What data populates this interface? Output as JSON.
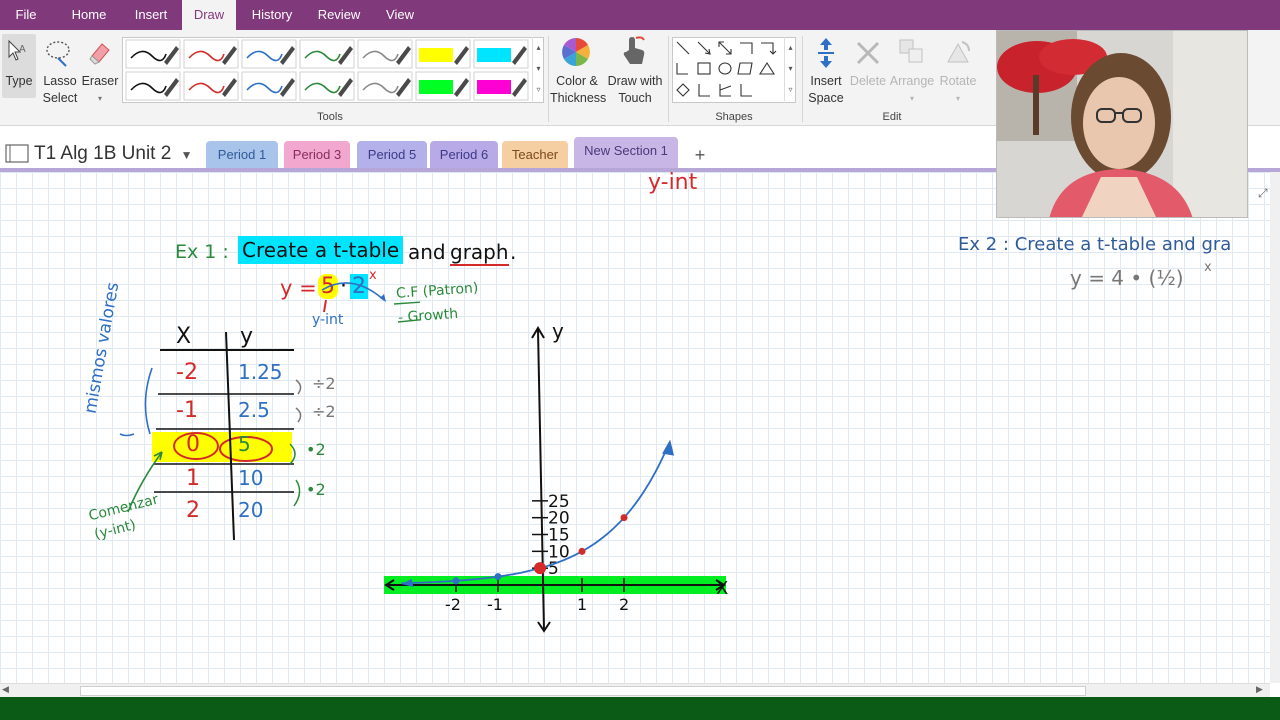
{
  "menu": {
    "items": [
      "File",
      "Home",
      "Insert",
      "Draw",
      "History",
      "Review",
      "View"
    ],
    "active": "Draw"
  },
  "ribbon": {
    "tools_group": {
      "type": "Type",
      "lasso_line1": "Lasso",
      "lasso_line2": "Select",
      "eraser": "Eraser",
      "label": "Tools"
    },
    "pens": {
      "row1": [
        "#111111",
        "#d42a2a",
        "#2f6fc4",
        "#2a8a3a",
        "#8a8a8a",
        "#ffff00",
        "#00e5ff"
      ],
      "row2": [
        "#111111",
        "#d42a2a",
        "#2f6fc4",
        "#2a8a3a",
        "#8a8a8a",
        "#00ff22",
        "#ff00d4"
      ]
    },
    "color_line1": "Color &",
    "color_line2": "Thickness",
    "touch_line1": "Draw with",
    "touch_line2": "Touch",
    "shapes_label": "Shapes",
    "edit": {
      "insert_line1": "Insert",
      "insert_line2": "Space",
      "delete": "Delete",
      "arrange": "Arrange",
      "rotate": "Rotate",
      "label": "Edit"
    }
  },
  "notebook": {
    "name": "T1 Alg 1B Unit 2",
    "tabs": [
      {
        "label": "Period 1",
        "color": "#a9c4ea",
        "text": "#2f5b9a"
      },
      {
        "label": "Period 3",
        "color": "#f2a7cf",
        "text": "#8a2c5f"
      },
      {
        "label": "Period 5",
        "color": "#b4b1ea",
        "text": "#3d3a8a"
      },
      {
        "label": "Period 6",
        "color": "#b8aae6",
        "text": "#3d3a8a"
      },
      {
        "label": "Teacher",
        "color": "#f5cfa2",
        "text": "#7a4a1a"
      },
      {
        "label": "New Section 1",
        "color": "#c8b6e6",
        "text": "#4a3a7a"
      }
    ],
    "add_tab": "+"
  },
  "page": {
    "top_note": "y-int",
    "ex1_prefix": "Ex 1 :",
    "ex1_highlight": "Create a t-table",
    "ex1_mid": "and",
    "ex1_graph": "graph",
    "ex1_dot": ".",
    "equation_lhs": "y =",
    "equation_a": "5",
    "equation_dot": "·",
    "equation_b": "2",
    "equation_exp": "x",
    "cf_label": "C.F (Patron)",
    "growth_label": "- Growth",
    "yint_label": "y-int",
    "side_note": "mismos valores",
    "start_note_1": "Comenzar",
    "start_note_2": "(y-int)",
    "table": {
      "col_x": "X",
      "col_y": "y",
      "rows": [
        {
          "x": "-2",
          "y": "1.25",
          "step": "÷2"
        },
        {
          "x": "-1",
          "y": "2.5",
          "step": "÷2"
        },
        {
          "x": "0",
          "y": "5",
          "step": "•2"
        },
        {
          "x": "1",
          "y": "10",
          "step": "•2"
        },
        {
          "x": "2",
          "y": "20",
          "step": ""
        }
      ]
    },
    "graph": {
      "x_axis": "X",
      "y_axis": "y",
      "y_ticks": [
        "25",
        "20",
        "15",
        "10",
        "5"
      ],
      "x_ticks": [
        "-2",
        "-1",
        "1",
        "2"
      ]
    },
    "ex2_text": "Ex 2 : Create a t-table and gra",
    "ex2_eq": "y = 4 • (½)"
  }
}
